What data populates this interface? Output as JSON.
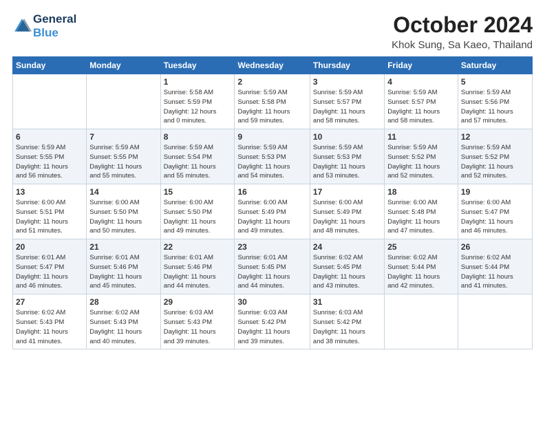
{
  "header": {
    "logo_line1": "General",
    "logo_line2": "Blue",
    "month": "October 2024",
    "location": "Khok Sung, Sa Kaeo, Thailand"
  },
  "weekdays": [
    "Sunday",
    "Monday",
    "Tuesday",
    "Wednesday",
    "Thursday",
    "Friday",
    "Saturday"
  ],
  "weeks": [
    [
      {
        "day": "",
        "info": ""
      },
      {
        "day": "",
        "info": ""
      },
      {
        "day": "1",
        "info": "Sunrise: 5:58 AM\nSunset: 5:59 PM\nDaylight: 12 hours\nand 0 minutes."
      },
      {
        "day": "2",
        "info": "Sunrise: 5:59 AM\nSunset: 5:58 PM\nDaylight: 11 hours\nand 59 minutes."
      },
      {
        "day": "3",
        "info": "Sunrise: 5:59 AM\nSunset: 5:57 PM\nDaylight: 11 hours\nand 58 minutes."
      },
      {
        "day": "4",
        "info": "Sunrise: 5:59 AM\nSunset: 5:57 PM\nDaylight: 11 hours\nand 58 minutes."
      },
      {
        "day": "5",
        "info": "Sunrise: 5:59 AM\nSunset: 5:56 PM\nDaylight: 11 hours\nand 57 minutes."
      }
    ],
    [
      {
        "day": "6",
        "info": "Sunrise: 5:59 AM\nSunset: 5:55 PM\nDaylight: 11 hours\nand 56 minutes."
      },
      {
        "day": "7",
        "info": "Sunrise: 5:59 AM\nSunset: 5:55 PM\nDaylight: 11 hours\nand 55 minutes."
      },
      {
        "day": "8",
        "info": "Sunrise: 5:59 AM\nSunset: 5:54 PM\nDaylight: 11 hours\nand 55 minutes."
      },
      {
        "day": "9",
        "info": "Sunrise: 5:59 AM\nSunset: 5:53 PM\nDaylight: 11 hours\nand 54 minutes."
      },
      {
        "day": "10",
        "info": "Sunrise: 5:59 AM\nSunset: 5:53 PM\nDaylight: 11 hours\nand 53 minutes."
      },
      {
        "day": "11",
        "info": "Sunrise: 5:59 AM\nSunset: 5:52 PM\nDaylight: 11 hours\nand 52 minutes."
      },
      {
        "day": "12",
        "info": "Sunrise: 5:59 AM\nSunset: 5:52 PM\nDaylight: 11 hours\nand 52 minutes."
      }
    ],
    [
      {
        "day": "13",
        "info": "Sunrise: 6:00 AM\nSunset: 5:51 PM\nDaylight: 11 hours\nand 51 minutes."
      },
      {
        "day": "14",
        "info": "Sunrise: 6:00 AM\nSunset: 5:50 PM\nDaylight: 11 hours\nand 50 minutes."
      },
      {
        "day": "15",
        "info": "Sunrise: 6:00 AM\nSunset: 5:50 PM\nDaylight: 11 hours\nand 49 minutes."
      },
      {
        "day": "16",
        "info": "Sunrise: 6:00 AM\nSunset: 5:49 PM\nDaylight: 11 hours\nand 49 minutes."
      },
      {
        "day": "17",
        "info": "Sunrise: 6:00 AM\nSunset: 5:49 PM\nDaylight: 11 hours\nand 48 minutes."
      },
      {
        "day": "18",
        "info": "Sunrise: 6:00 AM\nSunset: 5:48 PM\nDaylight: 11 hours\nand 47 minutes."
      },
      {
        "day": "19",
        "info": "Sunrise: 6:00 AM\nSunset: 5:47 PM\nDaylight: 11 hours\nand 46 minutes."
      }
    ],
    [
      {
        "day": "20",
        "info": "Sunrise: 6:01 AM\nSunset: 5:47 PM\nDaylight: 11 hours\nand 46 minutes."
      },
      {
        "day": "21",
        "info": "Sunrise: 6:01 AM\nSunset: 5:46 PM\nDaylight: 11 hours\nand 45 minutes."
      },
      {
        "day": "22",
        "info": "Sunrise: 6:01 AM\nSunset: 5:46 PM\nDaylight: 11 hours\nand 44 minutes."
      },
      {
        "day": "23",
        "info": "Sunrise: 6:01 AM\nSunset: 5:45 PM\nDaylight: 11 hours\nand 44 minutes."
      },
      {
        "day": "24",
        "info": "Sunrise: 6:02 AM\nSunset: 5:45 PM\nDaylight: 11 hours\nand 43 minutes."
      },
      {
        "day": "25",
        "info": "Sunrise: 6:02 AM\nSunset: 5:44 PM\nDaylight: 11 hours\nand 42 minutes."
      },
      {
        "day": "26",
        "info": "Sunrise: 6:02 AM\nSunset: 5:44 PM\nDaylight: 11 hours\nand 41 minutes."
      }
    ],
    [
      {
        "day": "27",
        "info": "Sunrise: 6:02 AM\nSunset: 5:43 PM\nDaylight: 11 hours\nand 41 minutes."
      },
      {
        "day": "28",
        "info": "Sunrise: 6:02 AM\nSunset: 5:43 PM\nDaylight: 11 hours\nand 40 minutes."
      },
      {
        "day": "29",
        "info": "Sunrise: 6:03 AM\nSunset: 5:43 PM\nDaylight: 11 hours\nand 39 minutes."
      },
      {
        "day": "30",
        "info": "Sunrise: 6:03 AM\nSunset: 5:42 PM\nDaylight: 11 hours\nand 39 minutes."
      },
      {
        "day": "31",
        "info": "Sunrise: 6:03 AM\nSunset: 5:42 PM\nDaylight: 11 hours\nand 38 minutes."
      },
      {
        "day": "",
        "info": ""
      },
      {
        "day": "",
        "info": ""
      }
    ]
  ]
}
